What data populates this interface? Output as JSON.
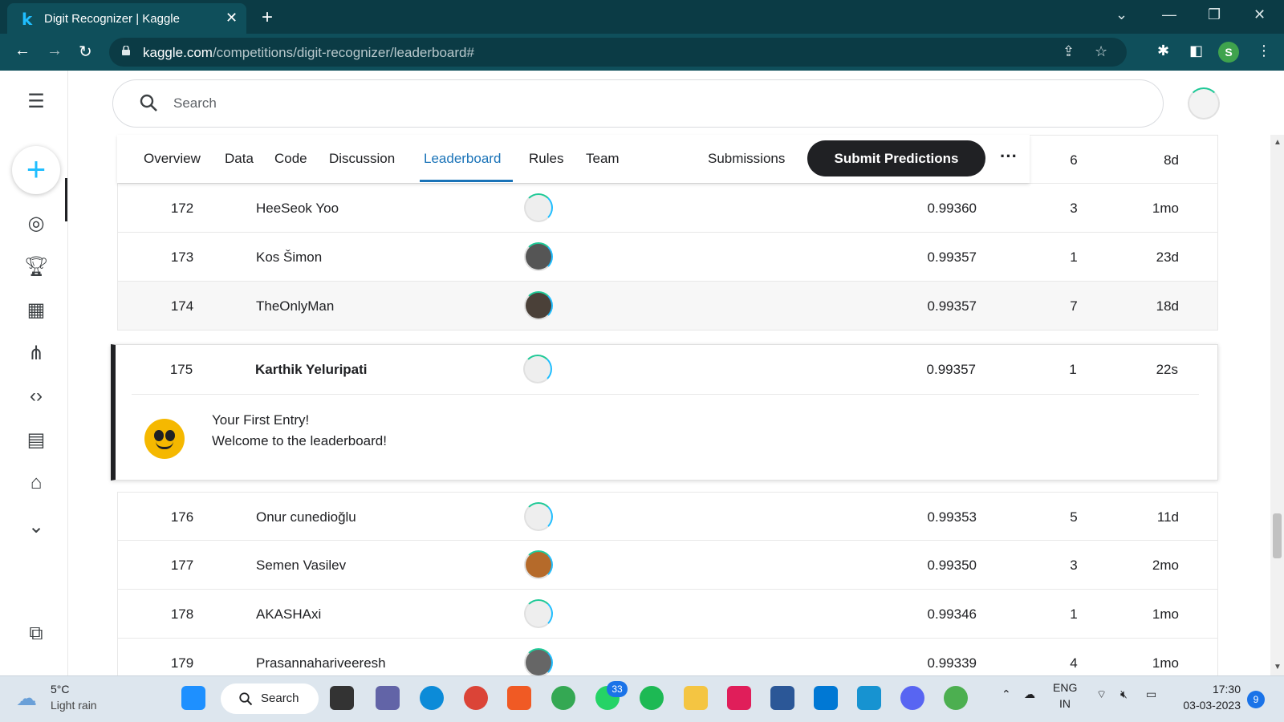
{
  "browser": {
    "tab_title": "Digit Recognizer | Kaggle",
    "url_host": "kaggle.com",
    "url_path": "/competitions/digit-recognizer/leaderboard#",
    "profile_initial": "S"
  },
  "search": {
    "placeholder": "Search"
  },
  "comp_nav": {
    "tabs": [
      "Overview",
      "Data",
      "Code",
      "Discussion",
      "Leaderboard",
      "Rules",
      "Team"
    ],
    "active": "Leaderboard",
    "submissions_label": "Submissions",
    "submit_label": "Submit Predictions",
    "more_label": "···"
  },
  "leaderboard": {
    "header_partial": {
      "entries": "6",
      "last": "8d"
    },
    "rows_above": [
      {
        "rank": "172",
        "name": "HeeSeok Yoo",
        "score": "0.99360",
        "entries": "3",
        "last": "1mo"
      },
      {
        "rank": "173",
        "name": "Kos Šimon",
        "score": "0.99357",
        "entries": "1",
        "last": "23d"
      },
      {
        "rank": "174",
        "name": "TheOnlyMan",
        "score": "0.99357",
        "entries": "7",
        "last": "18d"
      }
    ],
    "highlight": {
      "rank": "175",
      "name": "Karthik Yeluripati",
      "score": "0.99357",
      "entries": "1",
      "last": "22s",
      "message_line1": "Your First Entry!",
      "message_line2": "Welcome to the leaderboard!"
    },
    "rows_below": [
      {
        "rank": "176",
        "name": "Onur cunedioğlu",
        "score": "0.99353",
        "entries": "5",
        "last": "11d"
      },
      {
        "rank": "177",
        "name": "Semen Vasilev",
        "score": "0.99350",
        "entries": "3",
        "last": "2mo"
      },
      {
        "rank": "178",
        "name": "AKASHAxi",
        "score": "0.99346",
        "entries": "1",
        "last": "1mo"
      },
      {
        "rank": "179",
        "name": "Prasannahariveeresh",
        "score": "0.99339",
        "entries": "4",
        "last": "1mo"
      }
    ]
  },
  "taskbar": {
    "weather_temp": "5°C",
    "weather_desc": "Light rain",
    "search_label": "Search",
    "whatsapp_badge": "33",
    "lang_line1": "ENG",
    "lang_line2": "IN",
    "time": "17:30",
    "date": "03-03-2023",
    "notifications": "9"
  },
  "colors": {
    "chrome_dark": "#0b3b45",
    "chrome": "#0f4f5b",
    "kaggle_blue": "#20beff",
    "active_tab": "#1a73b8"
  }
}
